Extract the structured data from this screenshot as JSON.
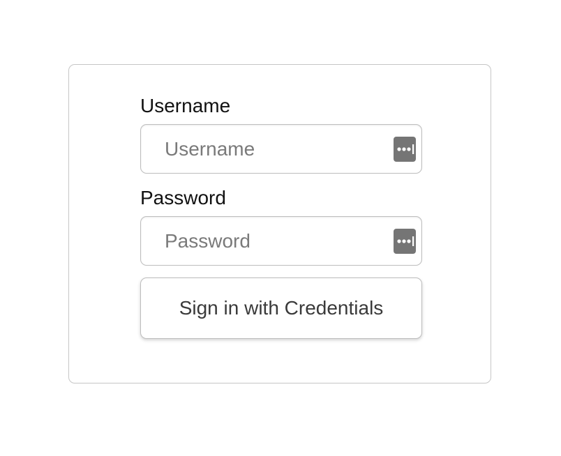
{
  "login_form": {
    "username": {
      "label": "Username",
      "value": "",
      "placeholder": "Username"
    },
    "password": {
      "label": "Password",
      "value": "",
      "placeholder": "Password"
    },
    "submit_label": "Sign in with Credentials",
    "icons": {
      "username_field_icon": "password-manager-icon",
      "password_field_icon": "password-manager-icon"
    }
  },
  "colors": {
    "border": "#bdbdbd",
    "icon_bg": "#757575",
    "placeholder": "#7a7a7a",
    "label_text": "#111111",
    "button_text": "#3a3a3a"
  }
}
